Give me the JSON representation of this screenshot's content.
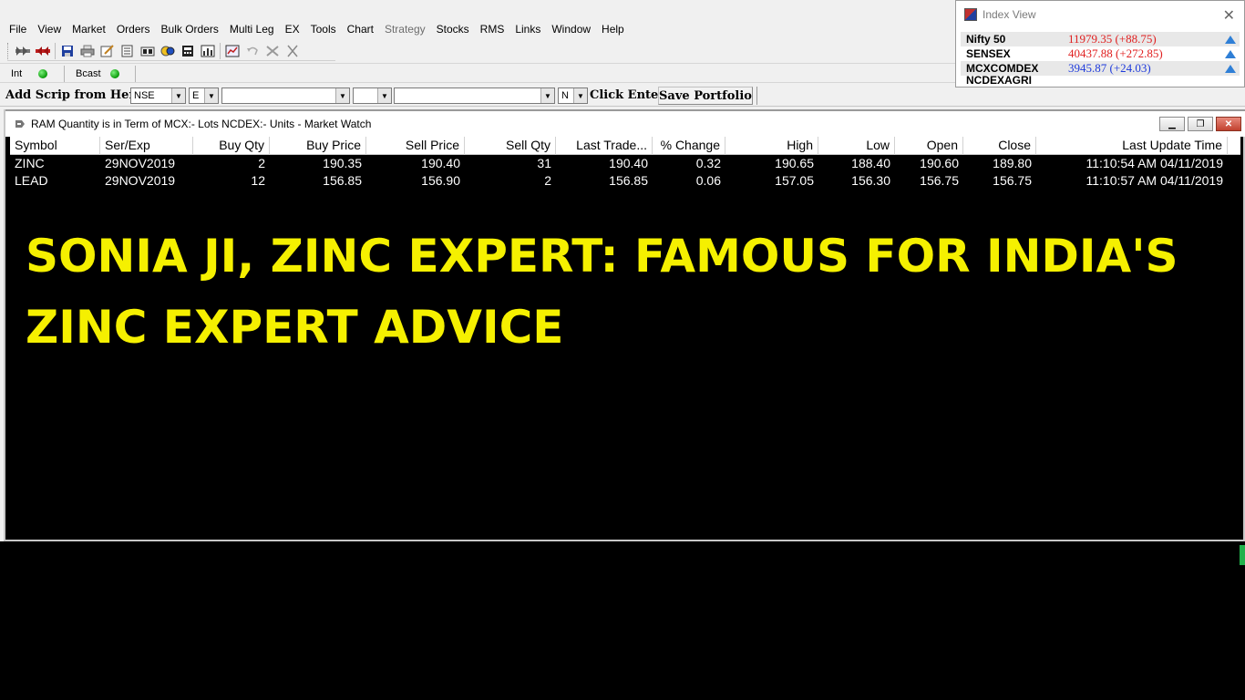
{
  "menu": [
    "File",
    "View",
    "Market",
    "Orders",
    "Bulk Orders",
    "Multi Leg",
    "EX",
    "Tools",
    "Chart",
    "Strategy",
    "Stocks",
    "RMS",
    "Links",
    "Window",
    "Help"
  ],
  "menu_disabled": [
    "Strategy"
  ],
  "toolbar_icons": [
    "grip-icon",
    "buy-icon",
    "sell-icon",
    "save-icon",
    "print-icon",
    "edit-icon",
    "report-icon",
    "quote-icon",
    "alert-icon",
    "calc-icon",
    "portfolio-icon",
    "graph-icon",
    "undo-icon",
    "tools-icon",
    "close-icon"
  ],
  "status": {
    "int_label": "Int",
    "bcast_label": "Bcast"
  },
  "scrip": {
    "label": "Add Scrip from Here",
    "exchange": "NSE",
    "segment": "E",
    "instrument": "",
    "series": "",
    "symbol": "",
    "option_type": "N",
    "click_enter": "Click Enter",
    "save_portfolio": "Save Portfolio"
  },
  "index_view": {
    "title": "Index View",
    "rows": [
      {
        "name": "Nifty 50",
        "value": "11979.35 (+88.75)",
        "color": "#e02020"
      },
      {
        "name": "SENSEX",
        "value": "40437.88 (+272.85)",
        "color": "#e02020"
      },
      {
        "name": "MCXCOMDEX",
        "value": "3945.87 (+24.03)",
        "color": "#1e3adc"
      },
      {
        "name": "NCDEXAGRI",
        "value": "",
        "color": "#000000"
      }
    ]
  },
  "market_watch": {
    "title": "RAM   Quantity is in Term of  MCX:- Lots  NCDEX:- Units - Market Watch",
    "columns": [
      "Symbol",
      "Ser/Exp",
      "Buy Qty",
      "Buy Price",
      "Sell Price",
      "Sell Qty",
      "Last Trade...",
      "% Change",
      "High",
      "Low",
      "Open",
      "Close",
      "Last Update Time"
    ],
    "rows": [
      [
        "ZINC",
        "29NOV2019",
        "2",
        "190.35",
        "190.40",
        "31",
        "190.40",
        "0.32",
        "190.65",
        "188.40",
        "190.60",
        "189.80",
        "11:10:54 AM 04/11/2019"
      ],
      [
        "LEAD",
        "29NOV2019",
        "12",
        "156.85",
        "156.90",
        "2",
        "156.85",
        "0.06",
        "157.05",
        "156.30",
        "156.75",
        "156.75",
        "11:10:57 AM 04/11/2019"
      ]
    ]
  },
  "banner": {
    "line1": "SONIA JI, ZINC EXPERT: FAMOUS FOR INDIA'S",
    "line2": "ZINC EXPERT ADVICE",
    "color": "#f5f000"
  }
}
